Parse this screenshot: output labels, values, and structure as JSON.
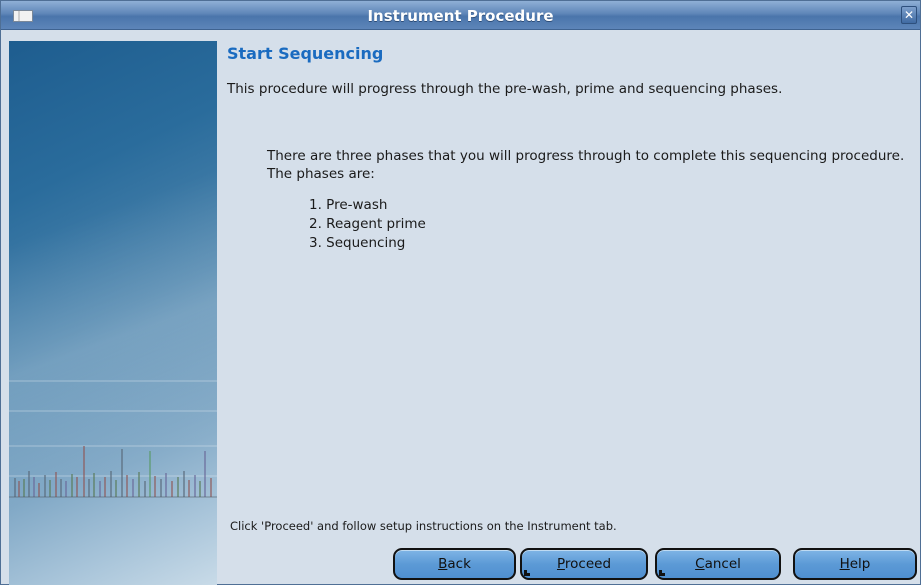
{
  "window": {
    "title": "Instrument Procedure"
  },
  "content": {
    "heading": "Start Sequencing",
    "intro": "This procedure will progress through the pre-wash, prime and sequencing phases.",
    "phases_text": "There are three phases that you will progress through to complete this sequencing procedure. The phases are:",
    "phases": [
      "1. Pre-wash",
      "2. Reagent prime",
      "3. Sequencing"
    ],
    "footer_note": "Click 'Proceed' and follow setup instructions on the Instrument tab."
  },
  "buttons": {
    "back": {
      "mnemonic": "B",
      "rest": "ack"
    },
    "proceed": {
      "mnemonic": "P",
      "rest": "roceed"
    },
    "cancel": {
      "mnemonic": "C",
      "rest": "ancel"
    },
    "help": {
      "mnemonic": "H",
      "rest": "elp"
    }
  },
  "colors": {
    "accent": "#1a6bc0",
    "titlebar": "#5f86b8",
    "background": "#d5dfea",
    "button": "#5c9ad6"
  },
  "icons": {
    "window_menu": "window-menu-icon",
    "close": "close-icon",
    "side_art": "sequencing-trace-art"
  }
}
